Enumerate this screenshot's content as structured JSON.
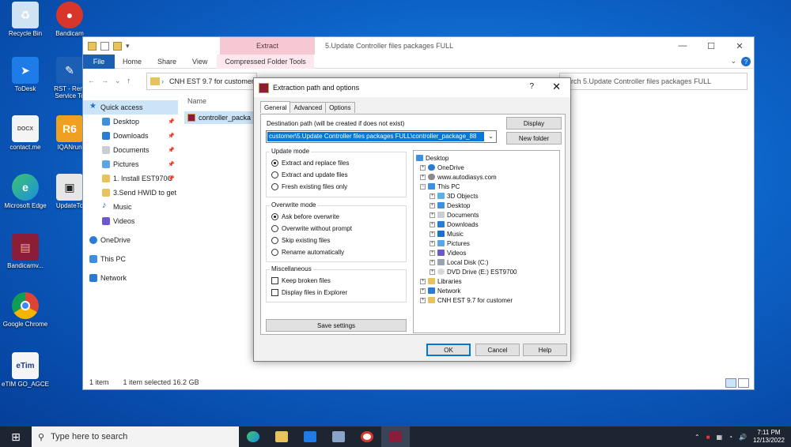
{
  "desktop": {
    "icons": [
      {
        "label": "Recycle Bin"
      },
      {
        "label": "Bandicam"
      },
      {
        "label": "ToDesk"
      },
      {
        "label": "RST - Rem Service To"
      },
      {
        "label": "contact.me"
      },
      {
        "label": "IQANrun"
      },
      {
        "label": "Microsoft Edge"
      },
      {
        "label": "UpdateTo"
      },
      {
        "label": "Bandicamv..."
      },
      {
        "label": "Google Chrome"
      },
      {
        "label": "eTIM GO_AGCE"
      }
    ],
    "icon_glyphs": {
      "docx": "DOCX",
      "r6": "R6",
      "etim": "eTim"
    }
  },
  "explorer": {
    "title": "5.Update Controller files packages FULL",
    "extract_tab": "Extract",
    "ribbon": {
      "file": "File",
      "home": "Home",
      "share": "Share",
      "view": "View",
      "compressed": "Compressed Folder Tools",
      "help": "?"
    },
    "address": "CNH EST 9.7 for customer",
    "search_placeholder": "earch 5.Update Controller files packages FULL",
    "column_name": "Name",
    "file_name": "controller_packa",
    "nav": {
      "quick_access": "Quick access",
      "desktop": "Desktop",
      "downloads": "Downloads",
      "documents": "Documents",
      "pictures": "Pictures",
      "install": "1. Install EST970C",
      "send_hwid": "3.Send HWID to get",
      "music": "Music",
      "videos": "Videos",
      "onedrive": "OneDrive",
      "thispc": "This PC",
      "network": "Network"
    },
    "status": {
      "count": "1 item",
      "selected": "1 item selected  16.2 GB"
    }
  },
  "dialog": {
    "title": "Extraction path and options",
    "help": "?",
    "tabs": {
      "general": "General",
      "advanced": "Advanced",
      "options": "Options"
    },
    "dest_label": "Destination path (will be created if does not exist)",
    "dest_value": "customer\\5.Update Controller files packages FULL\\controller_package_88",
    "display_btn": "Display",
    "newfolder_btn": "New folder",
    "update_mode": {
      "title": "Update mode",
      "options": [
        "Extract and replace files",
        "Extract and update files",
        "Fresh existing files only"
      ]
    },
    "overwrite_mode": {
      "title": "Overwrite mode",
      "options": [
        "Ask before overwrite",
        "Overwrite without prompt",
        "Skip existing files",
        "Rename automatically"
      ]
    },
    "misc": {
      "title": "Miscellaneous",
      "options": [
        "Keep broken files",
        "Display files in Explorer"
      ]
    },
    "save_settings": "Save settings",
    "tree": {
      "desktop": "Desktop",
      "onedrive": "OneDrive",
      "autodiasys": "www.autodiasys.com",
      "thispc": "This PC",
      "objects3d": "3D Objects",
      "desktop2": "Desktop",
      "documents": "Documents",
      "downloads": "Downloads",
      "music": "Music",
      "pictures": "Pictures",
      "videos": "Videos",
      "localdisk": "Local Disk (C:)",
      "dvd": "DVD Drive (E:) EST9700",
      "libraries": "Libraries",
      "network": "Network",
      "cnh": "CNH EST 9.7 for customer"
    },
    "ok": "OK",
    "cancel": "Cancel",
    "helpbtn": "Help"
  },
  "taskbar": {
    "search_placeholder": "Type here to search",
    "time": "7:11 PM",
    "date": "12/13/2022"
  }
}
